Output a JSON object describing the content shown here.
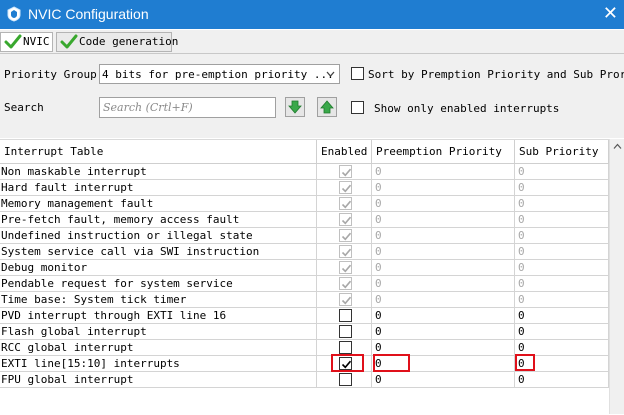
{
  "window": {
    "title": "NVIC Configuration",
    "close_glyph": "✕",
    "icon": "shield-icon"
  },
  "tabs": [
    {
      "label": "NVIC",
      "icon": "check-icon",
      "active": true
    },
    {
      "label": "Code generation",
      "icon": "check-icon",
      "active": false
    }
  ],
  "toolbar": {
    "priority_group_label": "Priority Group",
    "priority_group_value": "4 bits for pre-emption priority ...",
    "sort_label": "Sort by Premption Priority and Sub Prority",
    "search_label": "Search",
    "search_placeholder": "Search (Crtl+F)",
    "show_enabled_label": "Show only enabled interrupts"
  },
  "table": {
    "headers": [
      "Interrupt Table",
      "Enabled",
      "Preemption Priority",
      "Sub Priority"
    ],
    "rows": [
      {
        "name": "Non maskable interrupt",
        "enabled": true,
        "locked": true,
        "preemption": "0",
        "sub": "0"
      },
      {
        "name": "Hard fault interrupt",
        "enabled": true,
        "locked": true,
        "preemption": "0",
        "sub": "0"
      },
      {
        "name": "Memory management fault",
        "enabled": true,
        "locked": true,
        "preemption": "0",
        "sub": "0"
      },
      {
        "name": "Pre-fetch fault, memory access fault",
        "enabled": true,
        "locked": true,
        "preemption": "0",
        "sub": "0"
      },
      {
        "name": "Undefined instruction or illegal state",
        "enabled": true,
        "locked": true,
        "preemption": "0",
        "sub": "0"
      },
      {
        "name": "System service call via SWI instruction",
        "enabled": true,
        "locked": true,
        "preemption": "0",
        "sub": "0"
      },
      {
        "name": "Debug monitor",
        "enabled": true,
        "locked": true,
        "preemption": "0",
        "sub": "0"
      },
      {
        "name": "Pendable request for system service",
        "enabled": true,
        "locked": true,
        "preemption": "0",
        "sub": "0"
      },
      {
        "name": "Time base: System tick timer",
        "enabled": true,
        "locked": true,
        "preemption": "0",
        "sub": "0"
      },
      {
        "name": "PVD interrupt through EXTI line 16",
        "enabled": false,
        "locked": false,
        "preemption": "0",
        "sub": "0"
      },
      {
        "name": "Flash global interrupt",
        "enabled": false,
        "locked": false,
        "preemption": "0",
        "sub": "0"
      },
      {
        "name": "RCC global interrupt",
        "enabled": false,
        "locked": false,
        "preemption": "0",
        "sub": "0"
      },
      {
        "name": "EXTI line[15:10] interrupts",
        "enabled": true,
        "locked": false,
        "preemption": "0",
        "sub": "0"
      },
      {
        "name": "FPU global interrupt",
        "enabled": false,
        "locked": false,
        "preemption": "0",
        "sub": "0"
      }
    ]
  },
  "colors": {
    "titlebar": "#1f7dd1",
    "highlight": "#e0101a",
    "check_enabled": "#000000",
    "check_locked": "#a8a8a8"
  }
}
